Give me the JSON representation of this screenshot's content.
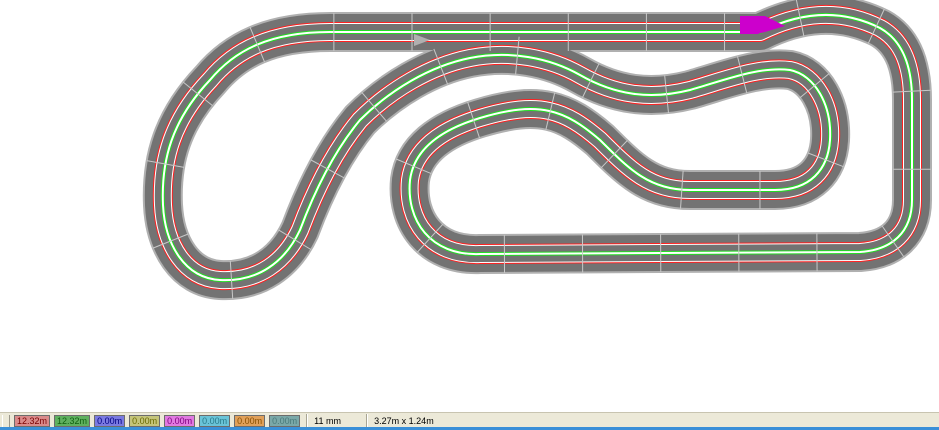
{
  "canvas": {
    "background": "#ffffff",
    "track_color": "#737373",
    "track_edge_color": "#b0b0b0",
    "lane_colors": [
      "#ff2020",
      "#22dd22"
    ],
    "start_marker_color": "#b0b0b0",
    "highlight_color": "#cc00cc"
  },
  "statusbar": {
    "lanes": [
      {
        "label": "12.32m",
        "bg": "#d98a8a",
        "fg": "#7a0000"
      },
      {
        "label": "12.32m",
        "bg": "#5fb05f",
        "fg": "#106010"
      },
      {
        "label": "0.00m",
        "bg": "#7a7ae0",
        "fg": "#000080"
      },
      {
        "label": "0.00m",
        "bg": "#c4c47a",
        "fg": "#6a6a00"
      },
      {
        "label": "0.00m",
        "bg": "#e07ae0",
        "fg": "#800080"
      },
      {
        "label": "0.00m",
        "bg": "#6ac4d8",
        "fg": "#2a7a8a"
      },
      {
        "label": "0.00m",
        "bg": "#e0a05a",
        "fg": "#8a5000"
      },
      {
        "label": "0.00m",
        "bg": "#7aa8a8",
        "fg": "#4a7a7a"
      }
    ],
    "grid": "11 mm",
    "size": "3.27m x 1.24m"
  }
}
